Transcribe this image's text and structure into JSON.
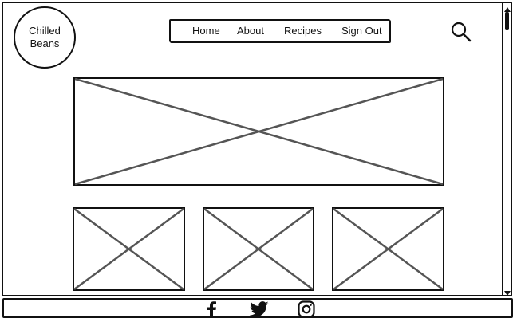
{
  "brand": {
    "line1": "Chilled",
    "line2": "Beans"
  },
  "nav": {
    "items": [
      {
        "label": "Home"
      },
      {
        "label": "About"
      },
      {
        "label": "Recipes"
      },
      {
        "label": "Sign Out"
      }
    ]
  },
  "header": {
    "search_icon": "search-icon"
  },
  "main": {
    "hero_image": "image-placeholder",
    "thumbnails": [
      "image-placeholder",
      "image-placeholder",
      "image-placeholder"
    ]
  },
  "footer": {
    "social_icons": [
      "facebook-icon",
      "twitter-icon",
      "instagram-icon"
    ]
  },
  "colors": {
    "outline": "#111111",
    "placeholder_cross": "#555555",
    "background": "#ffffff"
  }
}
